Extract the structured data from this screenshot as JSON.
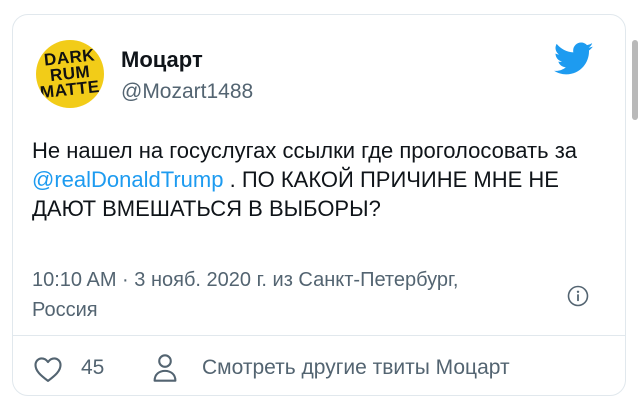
{
  "author": {
    "name": "Моцарт",
    "handle": "@Mozart1488",
    "avatar_text": [
      "DARK",
      "RUM",
      "MATTE"
    ]
  },
  "tweet": {
    "text_part1": "Не нашел на госуслугах ссылки где проголосовать за ",
    "mention": "@realDonaldTrump",
    "text_part2": " . ПО КАКОЙ ПРИЧИНЕ МНЕ НЕ ДАЮТ ВМЕШАТЬСЯ В ВЫБОРЫ?"
  },
  "meta": {
    "text": "10:10 AM · 3 нояб. 2020 г. из Санкт-Петербург, Россия"
  },
  "actions": {
    "like_count": "45",
    "more_tweets_label": "Смотреть другие твиты Моцарт"
  },
  "colors": {
    "accent": "#1d9bf0",
    "secondary_text": "#536471",
    "avatar_bg": "#f2cc18"
  }
}
